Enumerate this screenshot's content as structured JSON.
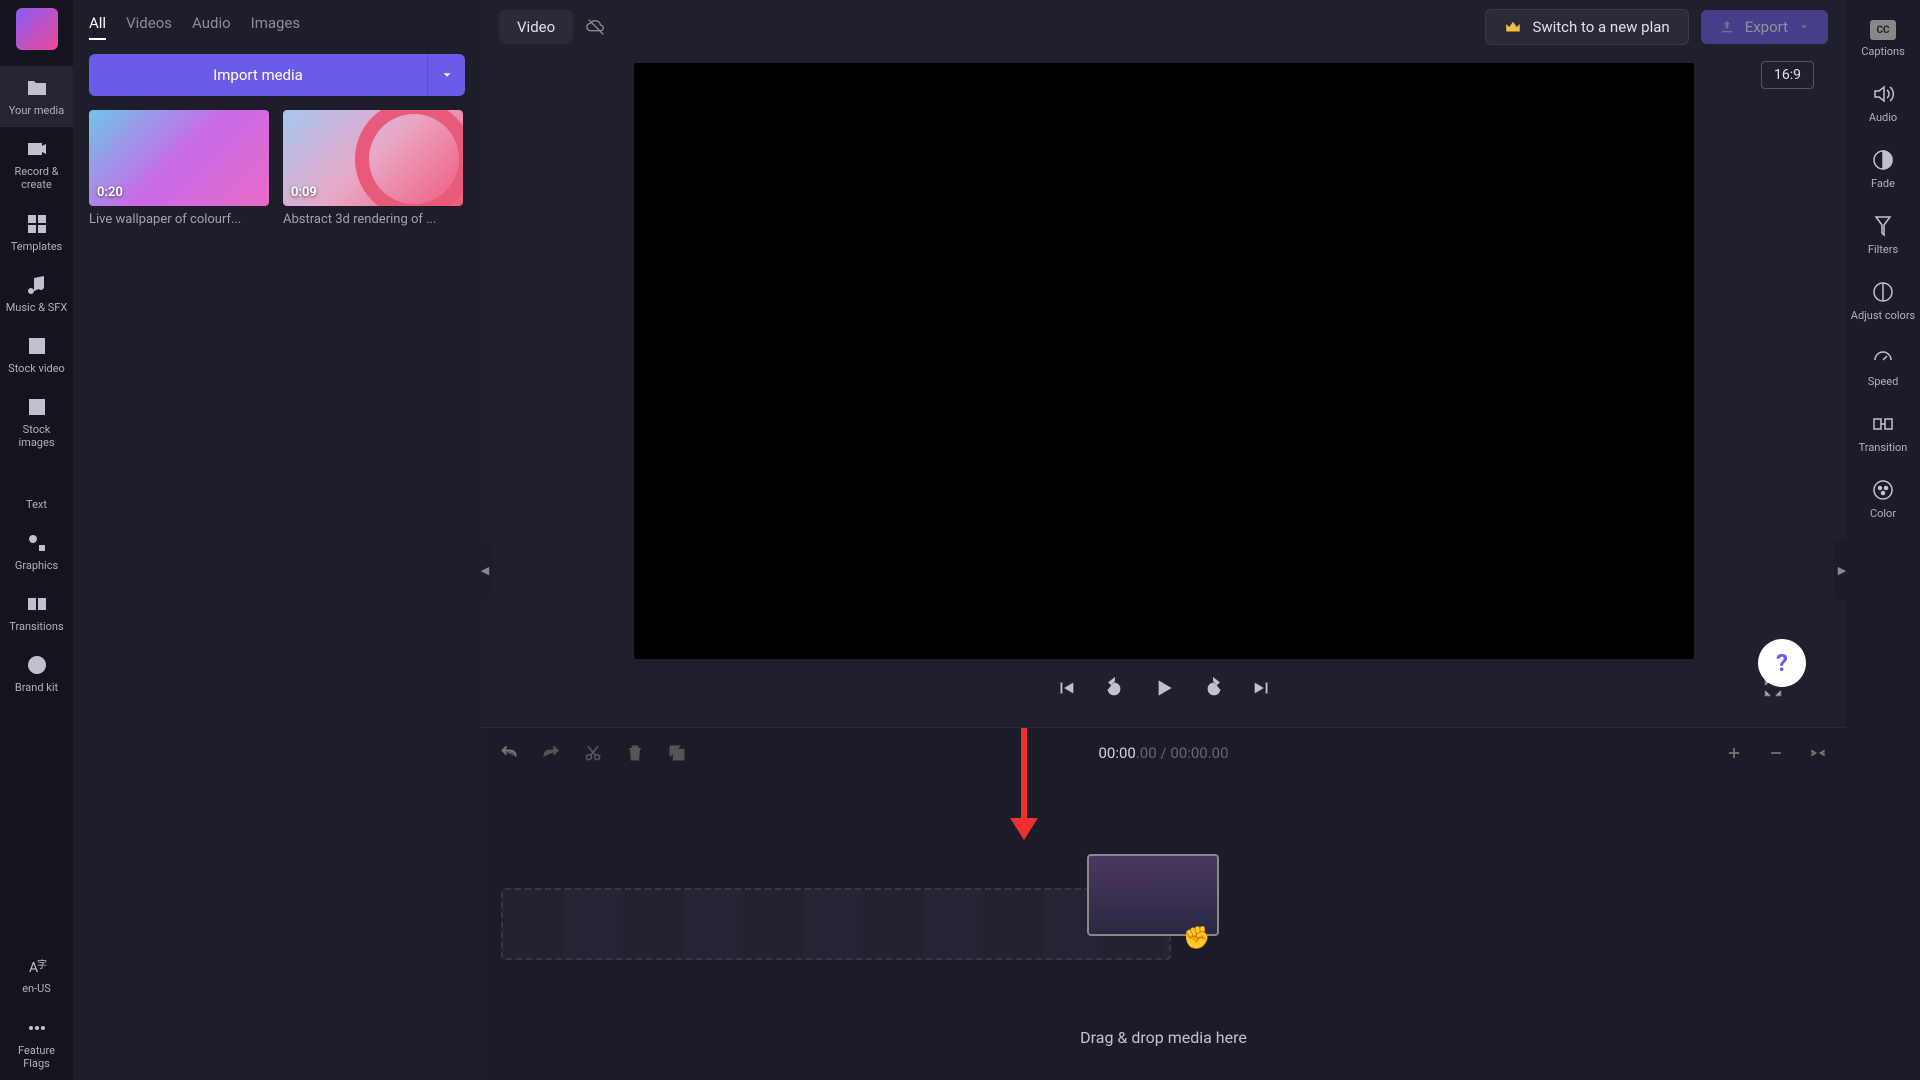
{
  "leftRail": {
    "items": [
      {
        "label": "Your media"
      },
      {
        "label": "Record & create"
      },
      {
        "label": "Templates"
      },
      {
        "label": "Music & SFX"
      },
      {
        "label": "Stock video"
      },
      {
        "label": "Stock images"
      },
      {
        "label": "Text"
      },
      {
        "label": "Graphics"
      },
      {
        "label": "Transitions"
      },
      {
        "label": "Brand kit"
      }
    ],
    "bottom": [
      {
        "label": "en-US"
      },
      {
        "label": "Feature Flags"
      }
    ]
  },
  "mediaPanel": {
    "tabs": [
      "All",
      "Videos",
      "Audio",
      "Images"
    ],
    "activeTab": "All",
    "importLabel": "Import media",
    "clips": [
      {
        "duration": "0:20",
        "label": "Live wallpaper of colourf..."
      },
      {
        "duration": "0:09",
        "label": "Abstract 3d rendering of ..."
      }
    ]
  },
  "topBar": {
    "projectType": "Video",
    "switchPlan": "Switch to a new plan",
    "export": "Export"
  },
  "preview": {
    "aspect": "16:9"
  },
  "timeline": {
    "timeCurrent": "00:00",
    "timeCurrentFrac": ".00",
    "timeTotal": "00:00",
    "timeTotalFrac": ".00",
    "hint": "Drag & drop media here"
  },
  "rightRail": {
    "items": [
      {
        "label": "Captions"
      },
      {
        "label": "Audio"
      },
      {
        "label": "Fade"
      },
      {
        "label": "Filters"
      },
      {
        "label": "Adjust colors"
      },
      {
        "label": "Speed"
      },
      {
        "label": "Transition"
      },
      {
        "label": "Color"
      }
    ]
  },
  "helpGlyph": "?"
}
